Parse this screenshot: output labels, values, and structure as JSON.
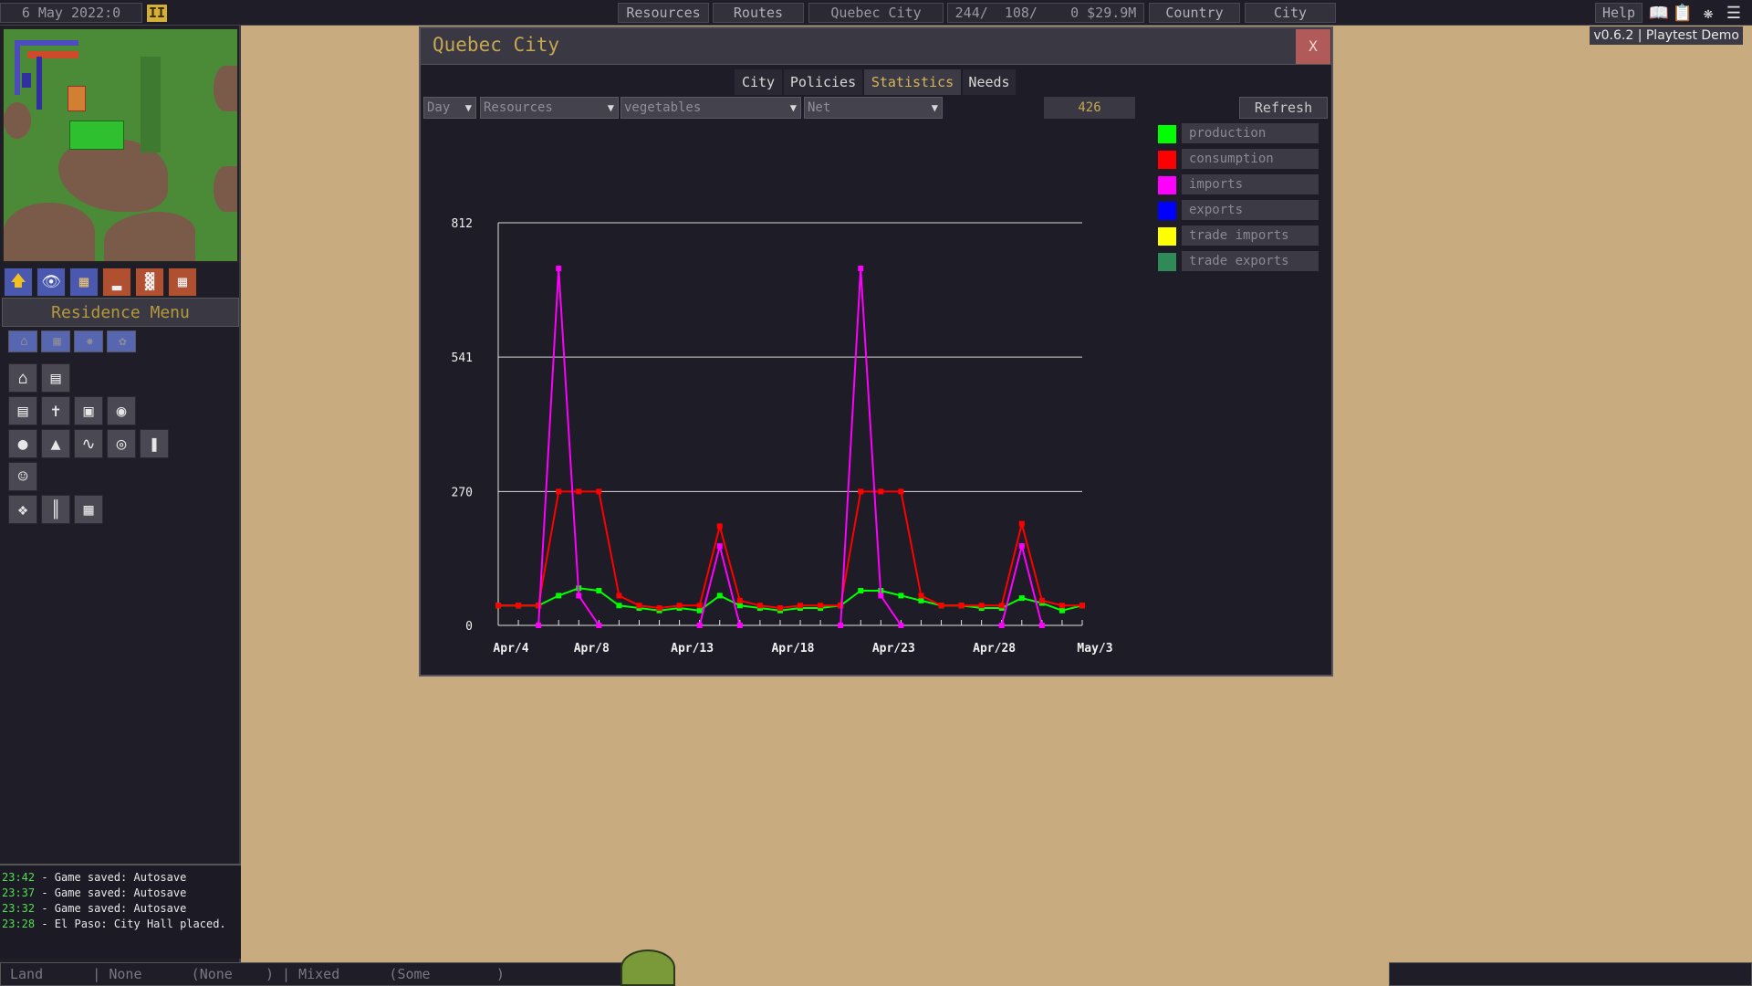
{
  "topbar": {
    "date": "6 May 2022:0",
    "pause_label": "II",
    "resources_label": "Resources",
    "routes_label": "Routes",
    "city_name": "Quebec City",
    "stats": "244/  108/    0 $29.9M",
    "country_label": "Country",
    "city_label": "City",
    "help_label": "Help",
    "icons": [
      "book-icon",
      "clipboard-icon",
      "bug-icon",
      "menu-icon"
    ]
  },
  "version": "v0.6.2 | Playtest Demo",
  "left_panel": {
    "tools": [
      "arrow-up-icon",
      "eye-icon",
      "map-icon",
      "road-icon",
      "rail-icon",
      "track-icon"
    ],
    "residence_menu_title": "Residence Menu",
    "buildings": [
      "house-icon",
      "factory-icon",
      "network-icon",
      "park-icon",
      "residence-icon",
      "store-icon",
      "fence-icon",
      "church-icon",
      "school-icon",
      "stadium-icon",
      "apple-icon",
      "silo-icon",
      "mask-icon",
      "sports-icon",
      "books-icon",
      "hospital-icon",
      "bird-icon",
      "road-piece-icon",
      "grid-icon"
    ]
  },
  "log": [
    {
      "time": "23:42",
      "text": " - Game saved: Autosave"
    },
    {
      "time": "23:37",
      "text": " - Game saved: Autosave"
    },
    {
      "time": "23:32",
      "text": " - Game saved: Autosave"
    },
    {
      "time": "23:28",
      "text": " - El Paso: City Hall placed."
    }
  ],
  "statusbar": "Land      | None      (None    ) | Mixed      (Some        )",
  "dialog": {
    "title": "Quebec City",
    "close_label": "X",
    "tabs": [
      "City",
      "Policies",
      "Statistics",
      "Needs"
    ],
    "active_tab": "Statistics",
    "period_select": "Day",
    "category_select": "Resources",
    "resource_select": "vegetables",
    "mode_select": "Net",
    "value": "426",
    "refresh_label": "Refresh",
    "legend": [
      {
        "name": "production",
        "color": "#00ff00"
      },
      {
        "name": "consumption",
        "color": "#ff0000"
      },
      {
        "name": "imports",
        "color": "#ff00ff"
      },
      {
        "name": "exports",
        "color": "#0000ff"
      },
      {
        "name": "trade imports",
        "color": "#ffff00"
      },
      {
        "name": "trade exports",
        "color": "#2e8b57"
      }
    ]
  },
  "chart_data": {
    "type": "line",
    "ylim": [
      0,
      812
    ],
    "yticks": [
      "812",
      "541",
      "270",
      "0"
    ],
    "ytick_values": [
      812,
      541,
      270,
      0
    ],
    "xticks": [
      "Apr/4",
      "Apr/8",
      "Apr/13",
      "Apr/18",
      "Apr/23",
      "Apr/28",
      "May/3"
    ],
    "xtick_index": [
      0,
      4,
      9,
      14,
      19,
      24,
      29
    ],
    "x": [
      "Apr/4",
      "Apr/5",
      "Apr/6",
      "Apr/7",
      "Apr/8",
      "Apr/9",
      "Apr/10",
      "Apr/11",
      "Apr/12",
      "Apr/13",
      "Apr/14",
      "Apr/15",
      "Apr/16",
      "Apr/17",
      "Apr/18",
      "Apr/19",
      "Apr/20",
      "Apr/21",
      "Apr/22",
      "Apr/23",
      "Apr/24",
      "Apr/25",
      "Apr/26",
      "Apr/27",
      "Apr/28",
      "Apr/29",
      "Apr/30",
      "May/1",
      "May/2",
      "May/3"
    ],
    "series": [
      {
        "name": "production",
        "color": "#00ff00",
        "values": [
          40,
          40,
          40,
          60,
          75,
          70,
          40,
          35,
          30,
          35,
          30,
          60,
          40,
          35,
          30,
          35,
          35,
          40,
          70,
          70,
          60,
          50,
          40,
          40,
          35,
          35,
          55,
          45,
          30,
          40
        ]
      },
      {
        "name": "consumption",
        "color": "#ff0000",
        "values": [
          40,
          40,
          40,
          270,
          270,
          270,
          60,
          40,
          35,
          40,
          40,
          200,
          50,
          40,
          35,
          40,
          40,
          40,
          270,
          270,
          270,
          60,
          40,
          40,
          40,
          40,
          205,
          50,
          40,
          40
        ]
      },
      {
        "name": "imports",
        "color": "#ff00ff",
        "values": [
          null,
          null,
          0,
          720,
          60,
          0,
          null,
          null,
          null,
          null,
          0,
          160,
          0,
          null,
          null,
          null,
          null,
          0,
          720,
          60,
          0,
          null,
          null,
          null,
          null,
          0,
          160,
          0,
          null,
          null
        ]
      }
    ],
    "grid": true
  }
}
